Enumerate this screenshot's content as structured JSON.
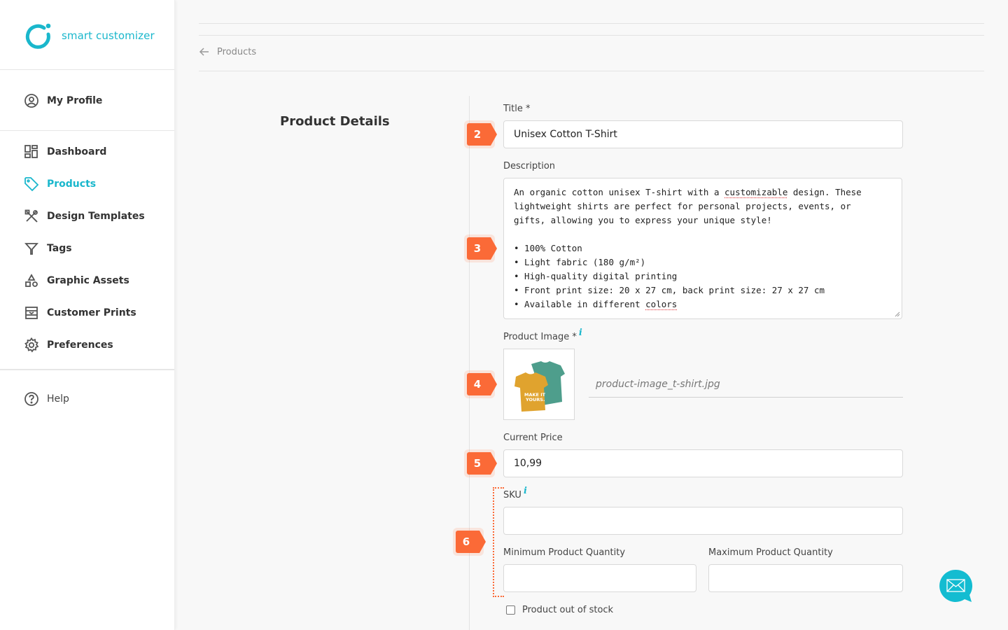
{
  "brand": {
    "name": "smart customizer",
    "color": "#1ab7cc"
  },
  "sidebar": {
    "profile": {
      "label": "My Profile",
      "icon": "user-circle-icon"
    },
    "items": [
      {
        "label": "Dashboard",
        "icon": "dashboard-icon",
        "active": false
      },
      {
        "label": "Products",
        "icon": "tag-icon",
        "active": true
      },
      {
        "label": "Design Templates",
        "icon": "design-tools-icon",
        "active": false
      },
      {
        "label": "Tags",
        "icon": "filter-icon",
        "active": false
      },
      {
        "label": "Graphic Assets",
        "icon": "shapes-icon",
        "active": false
      },
      {
        "label": "Customer Prints",
        "icon": "prints-icon",
        "active": false
      },
      {
        "label": "Preferences",
        "icon": "gear-icon",
        "active": false
      }
    ],
    "help": {
      "label": "Help",
      "icon": "question-circle-icon"
    }
  },
  "breadcrumb": {
    "back_label": "Products"
  },
  "section": {
    "title": "Product Details"
  },
  "form": {
    "title": {
      "label": "Title *",
      "value": "Unisex Cotton T-Shirt",
      "badge": "2"
    },
    "description": {
      "label": "Description",
      "badge": "3",
      "paragraph_before": "An organic cotton unisex T-shirt with a ",
      "spell_word_1": "customizable",
      "paragraph_after": " design. These\nlightweight shirts are perfect for personal projects, events, or\ngifts, allowing you to express your unique style!\n\n• 100% Cotton\n• Light fabric (180 g/m²)\n• High-quality digital printing\n• Front print size: 20 x 27 cm, back print size: 27 x 27 cm\n• Available in different ",
      "spell_word_2": "colors"
    },
    "product_image": {
      "label": "Product Image *",
      "info": "i",
      "filename": "product-image_t-shirt.jpg",
      "badge": "4",
      "image_text": "MAKE IT YOURS."
    },
    "current_price": {
      "label": "Current Price",
      "value": "10,99",
      "badge": "5"
    },
    "sku": {
      "label": "SKU",
      "info": "i",
      "value": "",
      "badge": "6"
    },
    "min_quantity": {
      "label": "Minimum Product Quantity",
      "value": ""
    },
    "max_quantity": {
      "label": "Maximum Product Quantity",
      "value": ""
    },
    "out_of_stock": {
      "label": "Product out of stock",
      "checked": false
    }
  },
  "colors": {
    "accent": "#1ab7cc",
    "badge": "#fb6a37",
    "text": "#333333"
  },
  "chat_button": {
    "icon": "mail-icon"
  }
}
